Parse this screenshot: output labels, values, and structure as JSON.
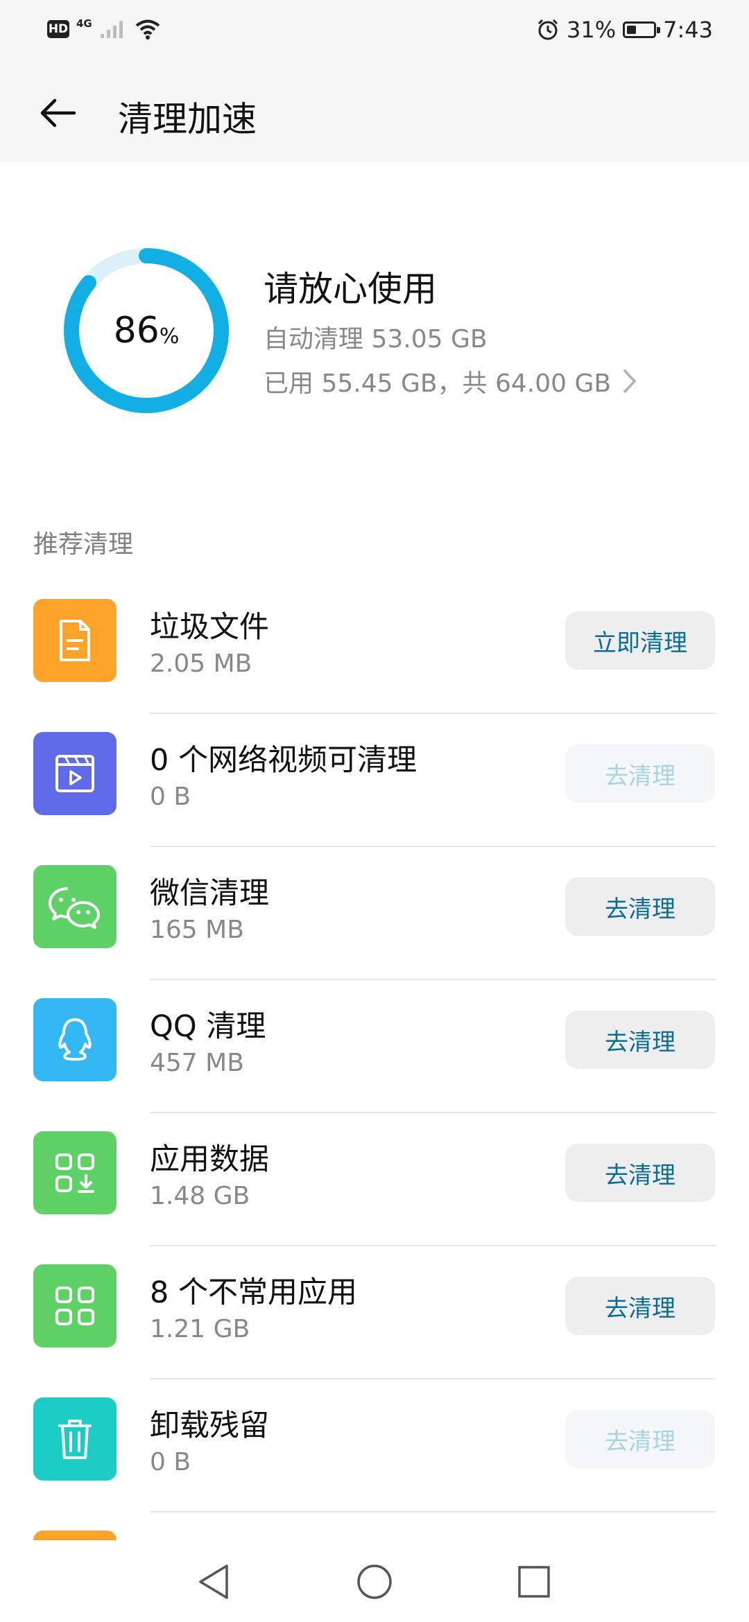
{
  "status_bar": {
    "hd": "HD",
    "network": "4G",
    "battery_percent": "31%",
    "battery_level": 0.31,
    "time": "7:43",
    "icons": [
      "signal-icon",
      "wifi-icon",
      "alarm-icon",
      "battery-icon"
    ]
  },
  "header": {
    "title": "清理加速",
    "back_icon": "back-arrow-icon"
  },
  "summary": {
    "percent_value": "86",
    "percent_unit": "%",
    "percent": 86,
    "title": "请放心使用",
    "auto_clean": "自动清理 53.05 GB",
    "usage": "已用 55.45 GB，共 64.00 GB"
  },
  "section": {
    "title": "推荐清理"
  },
  "items": [
    {
      "title": "垃圾文件",
      "subtitle": "2.05 MB",
      "button": "立即清理",
      "enabled": true,
      "icon": "document-icon",
      "color": "#ffa32a"
    },
    {
      "title": "0 个网络视频可清理",
      "subtitle": "0 B",
      "button": "去清理",
      "enabled": false,
      "icon": "video-icon",
      "color": "#5f6ae6"
    },
    {
      "title": "微信清理",
      "subtitle": "165 MB",
      "button": "去清理",
      "enabled": true,
      "icon": "wechat-icon",
      "color": "#5fd167"
    },
    {
      "title": "QQ 清理",
      "subtitle": "457 MB",
      "button": "去清理",
      "enabled": true,
      "icon": "qq-icon",
      "color": "#34b8f3"
    },
    {
      "title": "应用数据",
      "subtitle": "1.48 GB",
      "button": "去清理",
      "enabled": true,
      "icon": "app-data-icon",
      "color": "#5fd167"
    },
    {
      "title": "8 个不常用应用",
      "subtitle": "1.21 GB",
      "button": "去清理",
      "enabled": true,
      "icon": "apps-grid-icon",
      "color": "#5fd167"
    },
    {
      "title": "卸载残留",
      "subtitle": "0 B",
      "button": "去清理",
      "enabled": false,
      "icon": "trash-icon",
      "color": "#1dcdc5"
    }
  ],
  "nav": {
    "icons": [
      "back-triangle-icon",
      "home-circle-icon",
      "recents-square-icon"
    ]
  }
}
